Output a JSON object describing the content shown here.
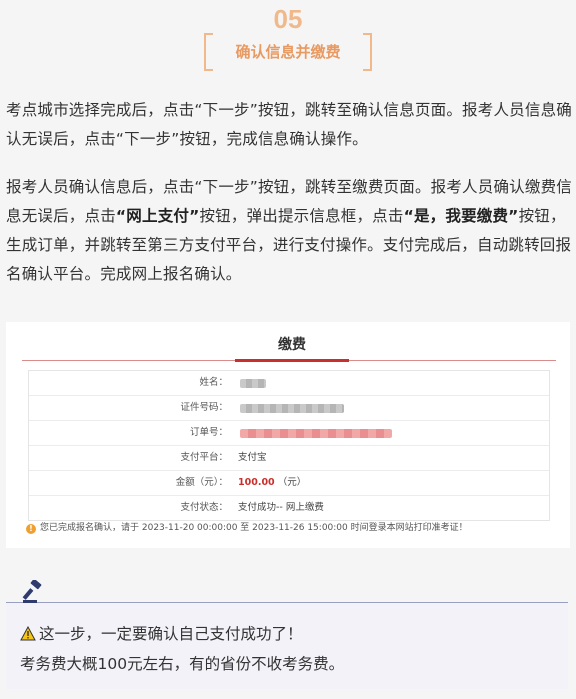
{
  "step": {
    "number": "05",
    "title": "确认信息并缴费"
  },
  "paragraphs": {
    "p1": "考点城市选择完成后，点击“下一步”按钮，跳转至确认信息页面。报考人员信息确认无误后，点击“下一步”按钮，完成信息确认操作。",
    "p2_a": "报考人员确认信息后，点击“下一步”按钮，跳转至缴费页面。报考人员确认缴费信息无误后，点击",
    "p2_bold1": "“网上支付”",
    "p2_b": "按钮，弹出提示信息框，点击",
    "p2_bold2": "“是，我要缴费”",
    "p2_c": "按钮，生成订单，并跳转至第三方支付平台，进行支付操作。支付完成后，自动跳转回报名确认平台。完成网上报名确认。"
  },
  "payment_card": {
    "title": "缴费",
    "rows": [
      {
        "label": "姓名：",
        "value": ""
      },
      {
        "label": "证件号码：",
        "value": ""
      },
      {
        "label": "订单号：",
        "value": ""
      },
      {
        "label": "支付平台：",
        "value": "支付宝"
      },
      {
        "label": "金额（元）：",
        "value": "100.00",
        "unit": "（元）"
      },
      {
        "label": "支付状态：",
        "value": "支付成功-- 网上缴费"
      }
    ],
    "notice": "您已完成报名确认，请于 2023-11-20 00:00:00 至 2023-11-26 15:00:00 时间登录本网站打印准考证！"
  },
  "tip": {
    "line1": "这一步，一定要确认自己支付成功了！",
    "line2": "考务费大概100元左右，有的省份不收考务费。"
  },
  "colors": {
    "accent_orange": "#e89a63",
    "brand_red": "#c9302c",
    "tip_border": "#9aa0c0"
  }
}
